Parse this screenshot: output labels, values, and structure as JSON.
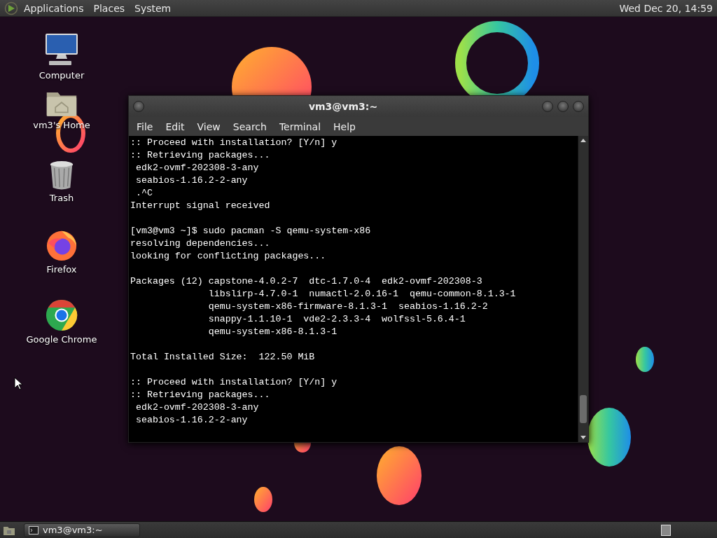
{
  "top_panel": {
    "menus": [
      "Applications",
      "Places",
      "System"
    ],
    "clock": "Wed Dec 20, 14:59"
  },
  "desktop_icons": [
    {
      "kind": "computer",
      "label": "Computer"
    },
    {
      "kind": "home",
      "label": "vm3's Home"
    },
    {
      "kind": "trash",
      "label": "Trash"
    },
    {
      "kind": "firefox",
      "label": "Firefox"
    },
    {
      "kind": "chrome",
      "label": "Google Chrome"
    }
  ],
  "terminal_window": {
    "title": "vm3@vm3:~",
    "menu": [
      "File",
      "Edit",
      "View",
      "Search",
      "Terminal",
      "Help"
    ],
    "output_blocks": [
      [
        ":: Proceed with installation? [Y/n] y",
        ":: Retrieving packages...",
        " edk2-ovmf-202308-3-any",
        " seabios-1.16.2-2-any",
        " .^C",
        "Interrupt signal received"
      ],
      [
        "[vm3@vm3 ~]$ sudo pacman -S qemu-system-x86",
        "resolving dependencies...",
        "looking for conflicting packages..."
      ],
      [
        "Packages (12) capstone-4.0.2-7  dtc-1.7.0-4  edk2-ovmf-202308-3",
        "              libslirp-4.7.0-1  numactl-2.0.16-1  qemu-common-8.1.3-1",
        "              qemu-system-x86-firmware-8.1.3-1  seabios-1.16.2-2",
        "              snappy-1.1.10-1  vde2-2.3.3-4  wolfssl-5.6.4-1",
        "              qemu-system-x86-8.1.3-1"
      ],
      [
        "Total Installed Size:  122.50 MiB"
      ],
      [
        ":: Proceed with installation? [Y/n] y",
        ":: Retrieving packages...",
        " edk2-ovmf-202308-3-any",
        " seabios-1.16.2-2-any"
      ]
    ]
  },
  "taskbar": {
    "tasks": [
      {
        "label": "vm3@vm3:~"
      }
    ]
  }
}
